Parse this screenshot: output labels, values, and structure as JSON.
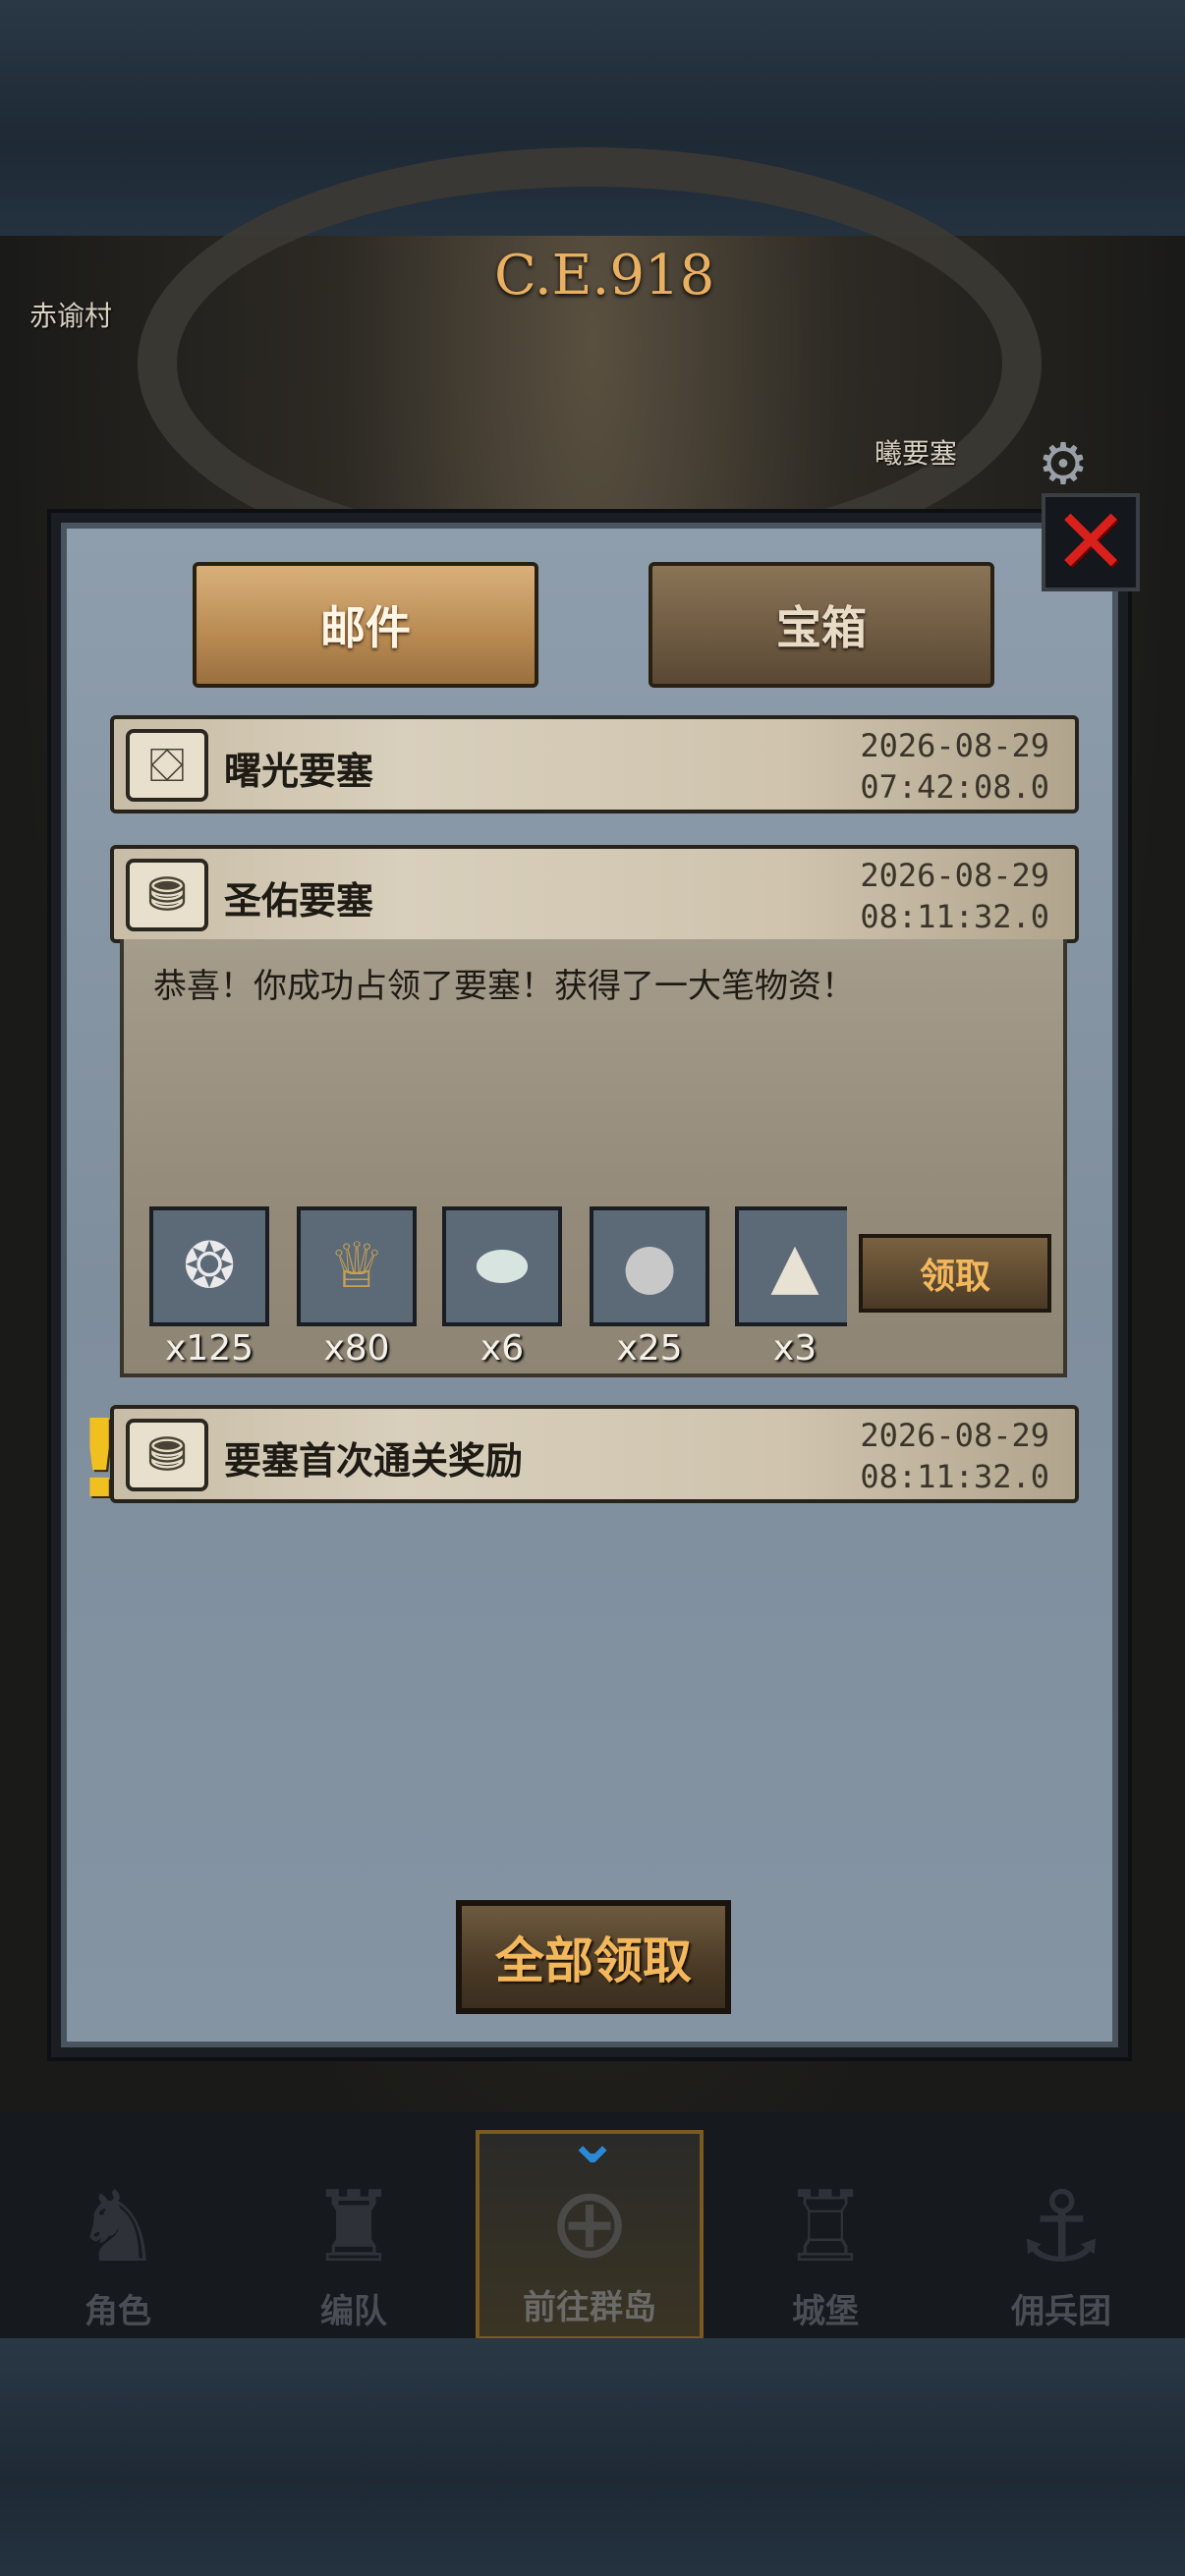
{
  "background": {
    "era": "C.E.918",
    "map_labels": [
      "赤谕村",
      "曦要塞"
    ]
  },
  "tabs": [
    {
      "label": "邮件",
      "active": true
    },
    {
      "label": "宝箱",
      "active": false
    }
  ],
  "mails": [
    {
      "title": "曙光要塞",
      "date": "2026-08-29",
      "time": "07:42:08.0",
      "icon": "chest-open-icon"
    },
    {
      "title": "圣佑要塞",
      "date": "2026-08-29",
      "time": "08:11:32.0",
      "icon": "chest-closed-icon",
      "expanded": true,
      "message": "恭喜！你成功占领了要塞！获得了一大笔物资！",
      "rewards": [
        {
          "icon": "ore-sack-icon",
          "count": "x125"
        },
        {
          "icon": "goblet-icon",
          "count": "x80"
        },
        {
          "icon": "gemstone-icon",
          "count": "x6"
        },
        {
          "icon": "silver-ore-icon",
          "count": "x25"
        },
        {
          "icon": "salt-pile-icon",
          "count": "x3"
        }
      ],
      "claim_label": "领取"
    },
    {
      "title": "要塞首次通关奖励",
      "date": "2026-08-29",
      "time": "08:11:32.0",
      "icon": "chest-closed-icon",
      "alert": true
    }
  ],
  "claim_all_label": "全部领取",
  "nav": [
    {
      "label": "角色",
      "icon": "knight-icon"
    },
    {
      "label": "编队",
      "icon": "helmet-icon"
    },
    {
      "label": "前往群岛",
      "icon": "globe-icon",
      "active": true
    },
    {
      "label": "城堡",
      "icon": "castle-icon"
    },
    {
      "label": "佣兵团",
      "icon": "ship-icon"
    }
  ],
  "colors": {
    "accent_orange": "#f4b85c",
    "close_red": "#d8201c",
    "alert_yellow": "#f0c020",
    "nav_chevron_blue": "#2a8ad8"
  }
}
